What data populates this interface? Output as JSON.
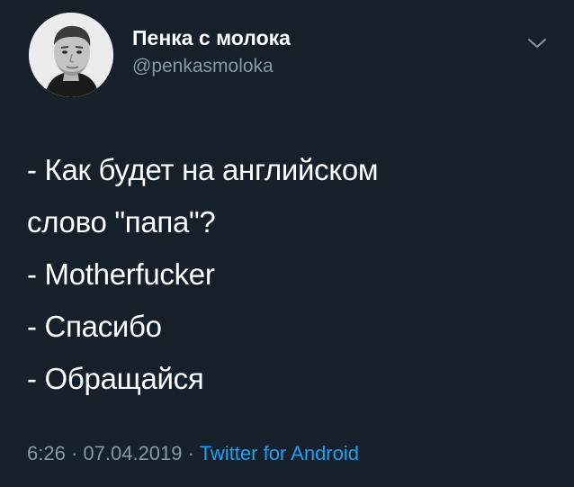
{
  "tweet": {
    "author": {
      "display_name": "Пенка с молока",
      "handle": "@penkasmoloka",
      "avatar_icon": "user-avatar-photo"
    },
    "menu_icon": "chevron-down-icon",
    "text_lines": [
      "- Как будет на английском",
      "слово \"папа\"?",
      "- Motherfucker",
      "- Спасибо",
      "- Обращайся"
    ],
    "time": "6:26",
    "separator": "·",
    "date": "07.04.2019",
    "source": "Twitter for Android"
  },
  "colors": {
    "background": "#15202b",
    "text": "#ffffff",
    "secondary": "#8899a6",
    "accent": "#1da1f2"
  }
}
